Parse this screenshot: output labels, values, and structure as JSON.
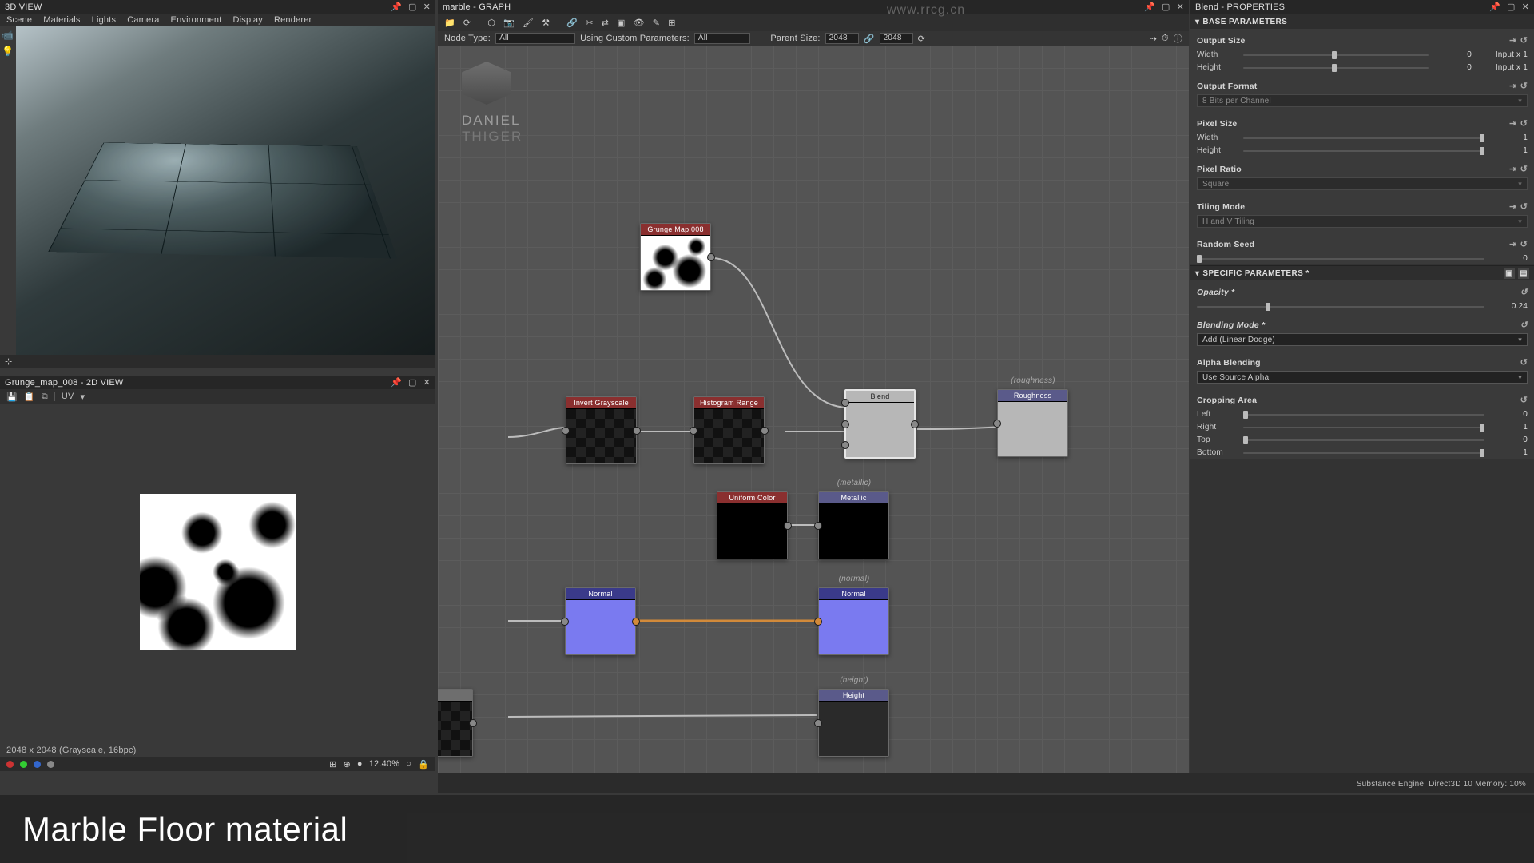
{
  "panel3d": {
    "title": "3D VIEW",
    "menu": [
      "Scene",
      "Materials",
      "Lights",
      "Camera",
      "Environment",
      "Display",
      "Renderer"
    ]
  },
  "panel2d": {
    "title": "Grunge_map_008 - 2D VIEW",
    "uv_label": "UV",
    "info": "2048 x 2048 (Grayscale, 16bpc)",
    "zoom": "12.40%"
  },
  "graph": {
    "title": "marble - GRAPH",
    "nodetype_label": "Node Type:",
    "nodetype_value": "All",
    "usingparams_label": "Using Custom Parameters:",
    "usingparams_value": "All",
    "parentsize_label": "Parent Size:",
    "parentsize_w": "2048",
    "parentsize_h": "2048",
    "logo": {
      "l1": "DANIEL",
      "l2": "THIGER"
    },
    "nodes": {
      "grunge": {
        "label": "Grunge Map 008"
      },
      "invert": {
        "label": "Invert Grayscale"
      },
      "hist": {
        "label": "Histogram Range"
      },
      "blend": {
        "label": "Blend"
      },
      "rough": {
        "label": "Roughness"
      },
      "uniform": {
        "label": "Uniform Color"
      },
      "metal": {
        "label": "Metallic"
      },
      "normal1": {
        "label": "Normal"
      },
      "normal2": {
        "label": "Normal"
      },
      "height": {
        "label": "Height"
      }
    },
    "labels": {
      "roughness": "(roughness)",
      "metallic": "(metallic)",
      "normal": "(normal)",
      "height": "(height)"
    }
  },
  "props": {
    "title": "Blend - PROPERTIES",
    "base_hdr": "BASE PARAMETERS",
    "output_size": "Output Size",
    "width": "Width",
    "height": "Height",
    "outsize_val": "0",
    "outsize_suffix": "Input x 1",
    "output_format": "Output Format",
    "output_format_val": "8 Bits per Channel",
    "pixel_size": "Pixel Size",
    "pixelsize_val": "1",
    "pixel_ratio": "Pixel Ratio",
    "pixel_ratio_val": "Square",
    "tiling_mode": "Tiling Mode",
    "tiling_mode_val": "H and V Tiling",
    "random_seed": "Random Seed",
    "random_seed_val": "0",
    "spec_hdr": "SPECIFIC PARAMETERS *",
    "opacity": "Opacity *",
    "opacity_val": "0.24",
    "blend_mode": "Blending Mode *",
    "blend_mode_val": "Add (Linear Dodge)",
    "alpha_blend": "Alpha Blending",
    "alpha_blend_val": "Use Source Alpha",
    "crop": "Cropping Area",
    "left": "Left",
    "right": "Right",
    "top": "Top",
    "bottom": "Bottom",
    "crop_l": "0",
    "crop_r": "1",
    "crop_t": "0",
    "crop_b": "1"
  },
  "status": {
    "text": "Substance Engine: Direct3D 10   Memory: 10%"
  },
  "watermark_url": "www.rrcg.cn",
  "caption": "Marble Floor material"
}
